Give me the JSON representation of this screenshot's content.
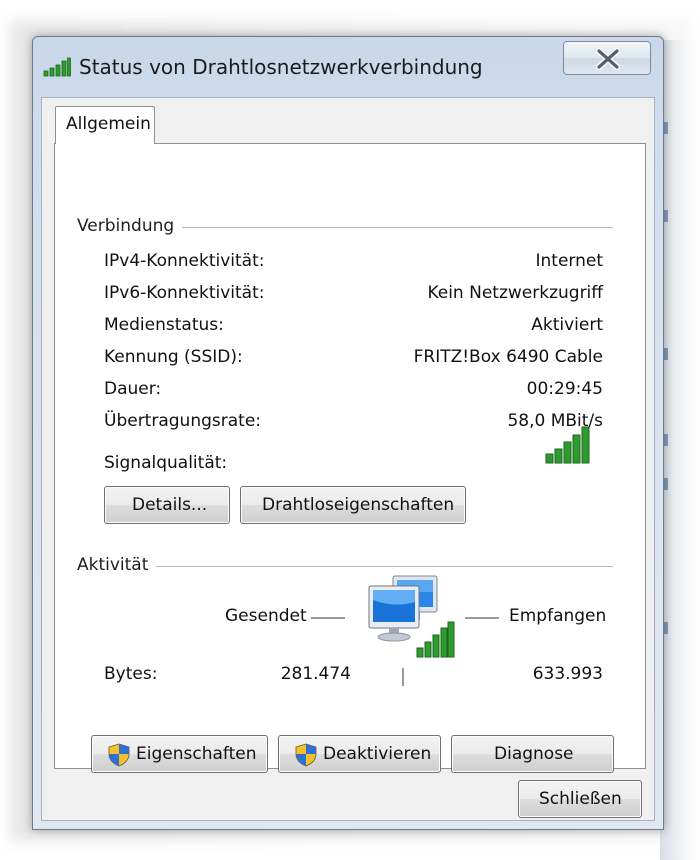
{
  "window": {
    "title": "Status von Drahtlosnetzwerkverbindung"
  },
  "tabs": [
    {
      "label": "Allgemein",
      "selected": true
    }
  ],
  "connection": {
    "section_title": "Verbindung",
    "rows": [
      {
        "label": "IPv4-Konnektivität:",
        "value": "Internet"
      },
      {
        "label": "IPv6-Konnektivität:",
        "value": "Kein Netzwerkzugriff"
      },
      {
        "label": "Medienstatus:",
        "value": "Aktiviert"
      },
      {
        "label": "Kennung (SSID):",
        "value": "FRITZ!Box 6490 Cable"
      },
      {
        "label": "Dauer:",
        "value": "00:29:45"
      },
      {
        "label": "Übertragungsrate:",
        "value": "58,0 MBit/s"
      }
    ],
    "signal_label": "Signalqualität:",
    "signal_bars": 5,
    "signal_bars_max": 5,
    "details_button": "Details...",
    "wireless_props_button": "Drahtloseigenschaften"
  },
  "activity": {
    "section_title": "Aktivität",
    "sent_label": "Gesendet",
    "received_label": "Empfangen",
    "bytes_label": "Bytes:",
    "bytes_sent": "281.474",
    "bytes_received": "633.993"
  },
  "buttons": {
    "properties": "Eigenschaften",
    "disable": "Deaktivieren",
    "diagnose": "Diagnose",
    "close": "Schließen"
  },
  "colors": {
    "signal_green": "#2f9b2f",
    "title_bar": "#c9d8ea",
    "monitor_blue": "#1a73d9",
    "shield_blue": "#2f6fd1",
    "shield_yellow": "#f2c12e"
  },
  "icons": {
    "title": "wireless-signal-icon",
    "close": "close-x-icon",
    "network": "network-computers-icon",
    "shield": "uac-shield-icon"
  }
}
